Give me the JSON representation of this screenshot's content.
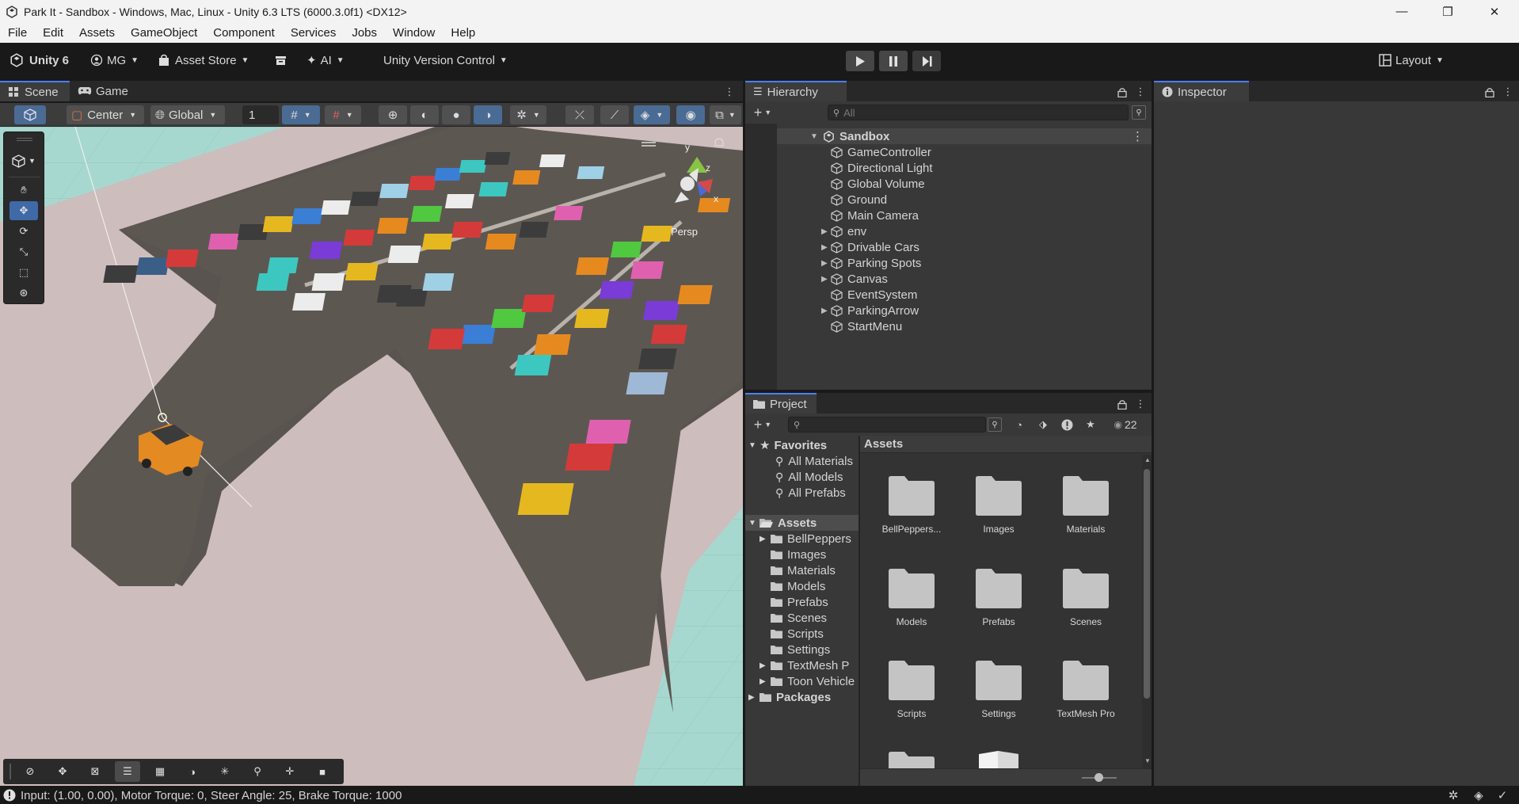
{
  "window": {
    "title": "Park It - Sandbox - Windows, Mac, Linux - Unity 6.3 LTS (6000.3.0f1) <DX12>",
    "minimize": "—",
    "maximize": "❐",
    "close": "✕"
  },
  "menu": [
    "File",
    "Edit",
    "Assets",
    "GameObject",
    "Component",
    "Services",
    "Jobs",
    "Window",
    "Help"
  ],
  "toolbar": {
    "unity_label": "Unity 6",
    "account_label": "MG",
    "asset_store_label": "Asset Store",
    "ai_label": "AI",
    "version_control_label": "Unity Version Control",
    "layout_label": "Layout"
  },
  "scene_panel": {
    "tab_scene": "Scene",
    "tab_game": "Game",
    "pivot_label": "Center",
    "space_label": "Global",
    "grid_snap_value": "1",
    "gizmo_axis_y": "y",
    "gizmo_axis_z": "z",
    "gizmo_axis_x": "x",
    "persp_label": "Persp"
  },
  "hierarchy": {
    "tab_label": "Hierarchy",
    "search_placeholder": "All",
    "scene_name": "Sandbox",
    "items": [
      {
        "label": "GameController",
        "expandable": false
      },
      {
        "label": "Directional Light",
        "expandable": false
      },
      {
        "label": "Global Volume",
        "expandable": false
      },
      {
        "label": "Ground",
        "expandable": false
      },
      {
        "label": "Main Camera",
        "expandable": false
      },
      {
        "label": "env",
        "expandable": true
      },
      {
        "label": "Drivable Cars",
        "expandable": true
      },
      {
        "label": "Parking Spots",
        "expandable": true
      },
      {
        "label": "Canvas",
        "expandable": true
      },
      {
        "label": "EventSystem",
        "expandable": false
      },
      {
        "label": "ParkingArrow",
        "expandable": true
      },
      {
        "label": "StartMenu",
        "expandable": false
      }
    ]
  },
  "inspector": {
    "tab_label": "Inspector"
  },
  "project": {
    "tab_label": "Project",
    "hidden_count": "22",
    "favorites_label": "Favorites",
    "favorites": [
      "All Materials",
      "All Models",
      "All Prefabs"
    ],
    "assets_label": "Assets",
    "asset_folders": [
      "BellPeppers",
      "Images",
      "Materials",
      "Models",
      "Prefabs",
      "Scenes",
      "Scripts",
      "Settings",
      "TextMesh P",
      "Toon Vehicle"
    ],
    "packages_label": "Packages",
    "breadcrumb": "Assets",
    "grid_items": [
      "BellPeppers...",
      "Images",
      "Materials",
      "Models",
      "Prefabs",
      "Scenes",
      "Scripts",
      "Settings",
      "TextMesh Pro"
    ]
  },
  "status": {
    "message": "Input: (1.00, 0.00), Motor Torque: 0, Steer Angle: 25, Brake Torque: 1000"
  }
}
